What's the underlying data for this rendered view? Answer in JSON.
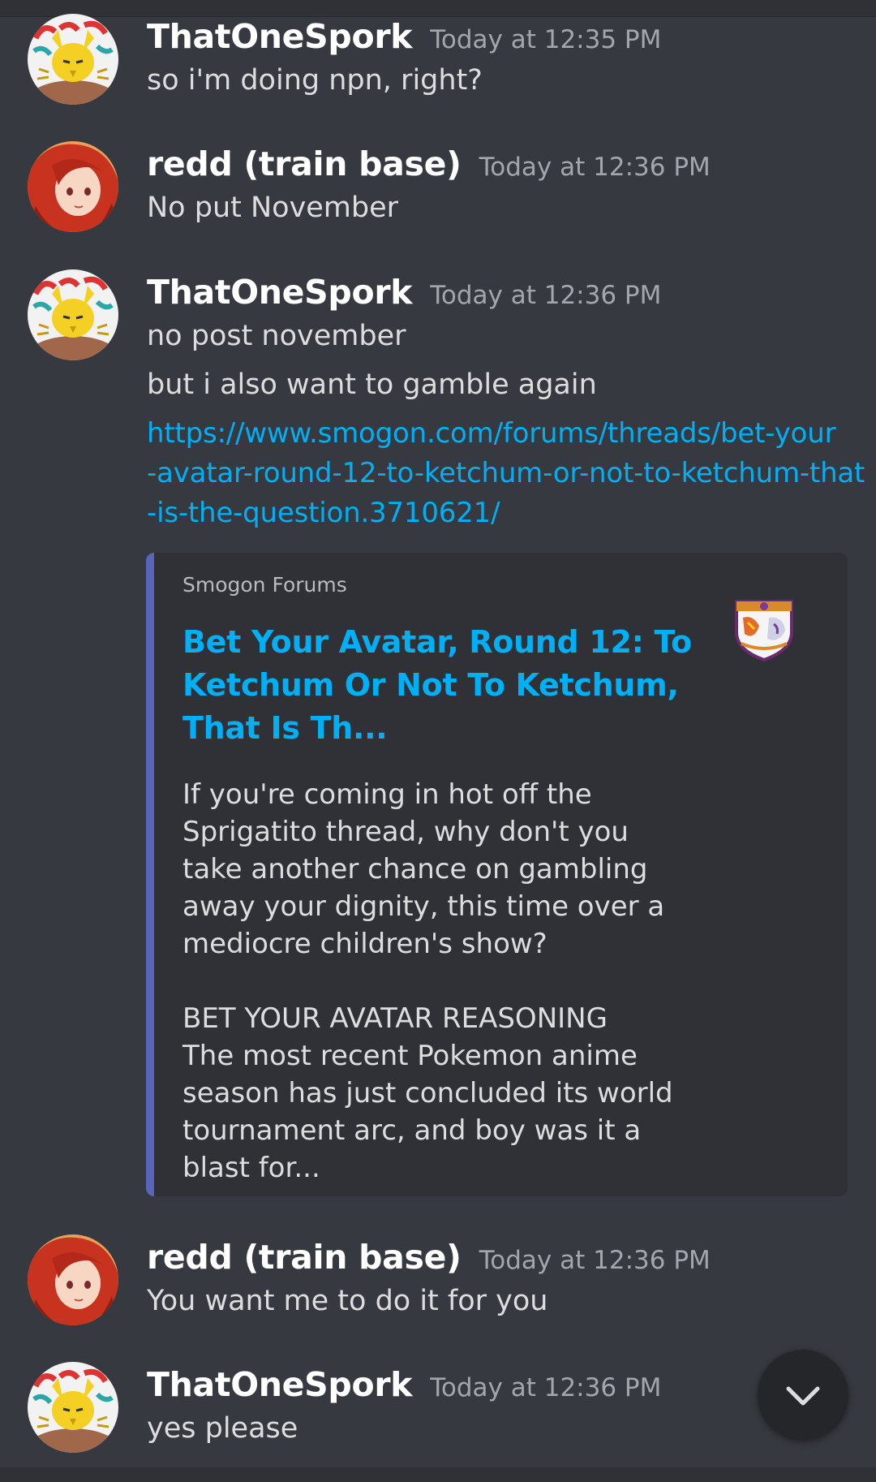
{
  "colors": {
    "background": "#36393f",
    "username": "#ffffff",
    "timestamp": "#a3a6aa",
    "link": "#00aff4",
    "embed_background": "#2f3136",
    "embed_accent": "#5865b9"
  },
  "messages": [
    {
      "author": "ThatOneSpork",
      "timestamp": "Today at 12:35 PM",
      "avatar": "spork-avatar",
      "lines": [
        "so i'm doing npn, right?"
      ]
    },
    {
      "author": "redd (train base)",
      "timestamp": "Today at 12:36 PM",
      "avatar": "red-hair-anime-avatar",
      "lines": [
        "No put November"
      ]
    },
    {
      "author": "ThatOneSpork",
      "timestamp": "Today at 12:36 PM",
      "avatar": "spork-avatar",
      "lines": [
        "no post november",
        "but i also want to gamble again"
      ],
      "link_lines": [
        "https://www.smogon.com/forums/threads/bet-your",
        "-avatar-round-12-to-ketchum-or-not-to-ketchum-that",
        "-is-the-question.3710621/"
      ],
      "embed": {
        "provider": "Smogon Forums",
        "title_lines": [
          "Bet Your Avatar, Round 12: To",
          "Ketchum Or Not To Ketchum,",
          "That Is Th..."
        ],
        "description_lines": [
          "If you're coming in hot off the",
          "Sprigatito thread, why don't you",
          "take another chance on gambling",
          "away your dignity, this time over a",
          "mediocre children's show?",
          "",
          "BET YOUR AVATAR REASONING",
          "The most recent Pokemon anime",
          "season has just concluded its world",
          "tournament arc, and boy was it a",
          "blast for..."
        ],
        "thumbnail": "smogon-logo-icon"
      }
    },
    {
      "author": "redd (train base)",
      "timestamp": "Today at 12:36 PM",
      "avatar": "red-hair-anime-avatar",
      "lines": [
        "You want me to do it for you"
      ]
    },
    {
      "author": "ThatOneSpork",
      "timestamp": "Today at 12:36 PM",
      "avatar": "spork-avatar",
      "lines": [
        "yes please"
      ]
    }
  ],
  "jump_button": {
    "icon": "chevron-down-icon"
  }
}
